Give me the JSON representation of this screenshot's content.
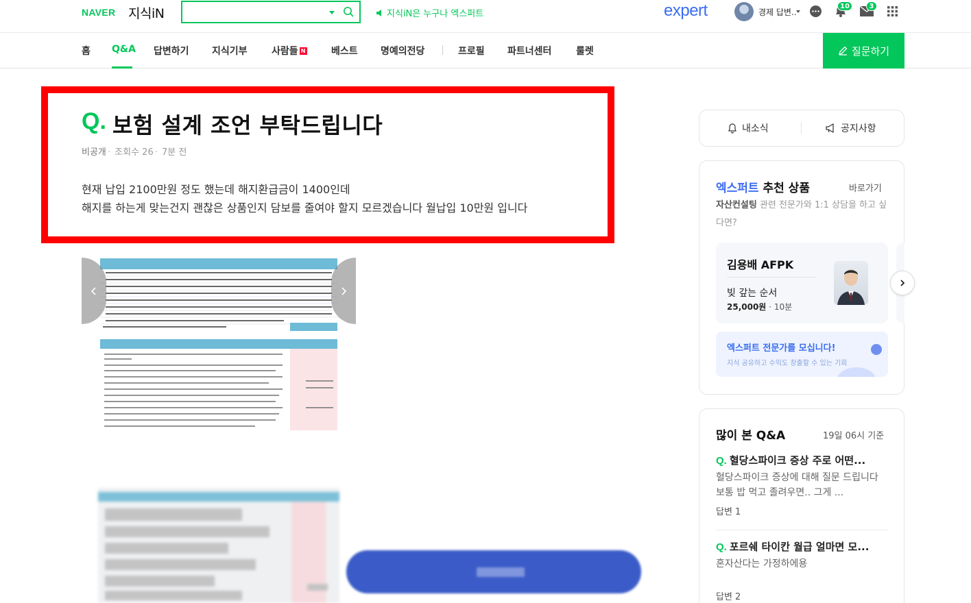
{
  "header": {
    "brand": "NAVER",
    "service": "지식iN",
    "search_placeholder": "",
    "notice": "지식iN은 누구나 엑스퍼트",
    "expert_logo": "expert",
    "user_name": "경제 답변..",
    "bell_count": "10",
    "mail_count": "3"
  },
  "nav": {
    "items": [
      "홈",
      "Q&A",
      "답변하기",
      "지식기부",
      "사람들",
      "베스트",
      "명예의전당",
      "프로필",
      "파트너센터",
      "룰렛"
    ],
    "active": "Q&A",
    "new_badge": "N",
    "ask_button": "질문하기"
  },
  "question": {
    "q_mark": "Q.",
    "title": "보험 설계 조언 부탁드립니다",
    "author": "비공개",
    "views_label": "조회수 26",
    "time": "7분 전",
    "body_lines": [
      "현재 납입 2100만원 정도 했는데 해지환급금이 1400인데",
      "해지를 하는게 맞는건지 괜찮은 상품인지 담보를 줄여야 할지 모르겠습니다 월납입 10만원 입니다"
    ]
  },
  "sidebar": {
    "my_news": "내소식",
    "notice": "공지사항",
    "expert": {
      "title_brand": "엑스퍼트",
      "title_rest": " 추천 상품",
      "link": "바로가기",
      "desc_bold": "자산컨설팅",
      "desc_rest": " 관련 전문가와 1:1 상담을 하고 싶다면?",
      "card": {
        "name": "김용배 AFPK",
        "product": "빚 갚는 순서",
        "price": "25,000원",
        "duration": "10분"
      },
      "recruit_title": "엑스퍼트 전문가를 모십니다!",
      "recruit_sub": "지식 공유하고 수익도 창출할 수 있는 기회"
    },
    "popular": {
      "title": "많이 본 Q&A",
      "time": "19일 06시 기준",
      "items": [
        {
          "q": "혈당스파이크 증상 주로 어떤...",
          "body": "혈당스파이크 증상에 대해 질문 드립니다 보통 밥 먹고 졸려우면.. 그게 ...",
          "answers": "답변 1"
        },
        {
          "q": "포르쉐 타이칸 월급 얼마면 모...",
          "body": "혼자산다는 가정하에용",
          "answers": "답변 2"
        }
      ]
    }
  },
  "colors": {
    "brand_green": "#03c75a",
    "expert_blue": "#3a6df0",
    "highlight_red": "#ff0000"
  }
}
